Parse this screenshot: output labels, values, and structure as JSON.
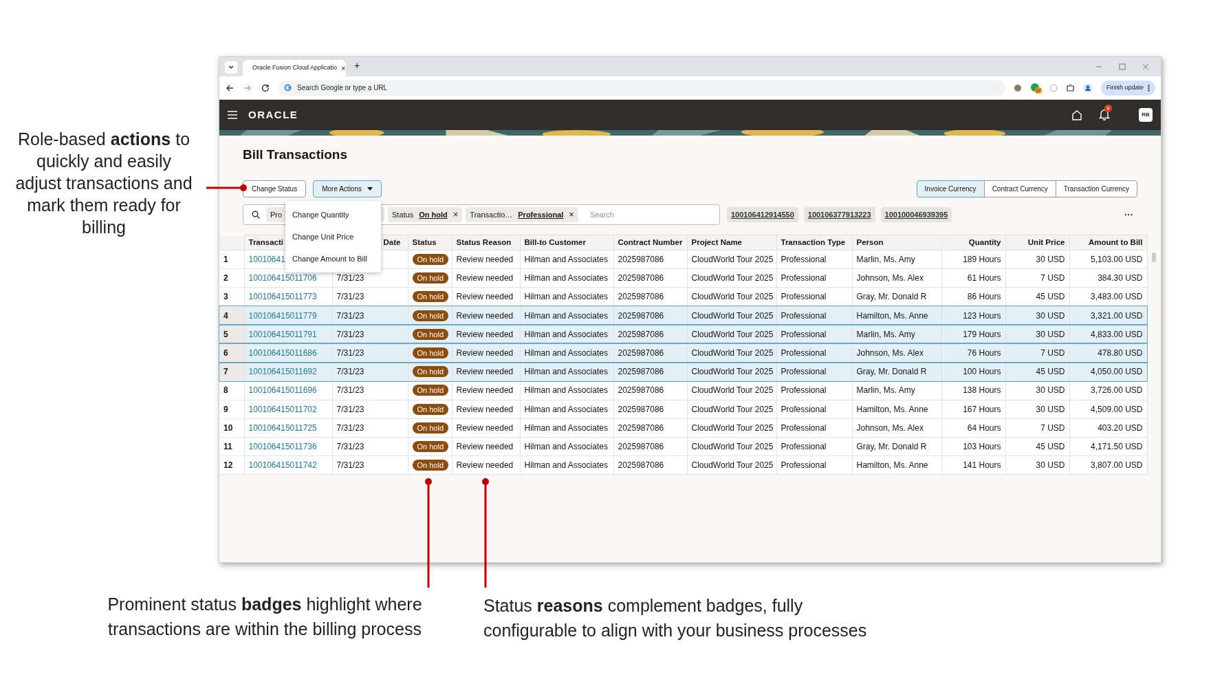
{
  "callouts": [
    {
      "text": "Role-based **actions** to quickly and easily adjust transactions and mark them ready for billing"
    },
    {
      "text": "Prominent status **badges** highlight where transactions are within the billing process"
    },
    {
      "text": "Status **reasons** complement badges, fully configurable to align with your business processes"
    }
  ],
  "browser": {
    "tab_title": "Oracle Fusion Cloud Applicatio",
    "tab_close": "×",
    "new_tab": "+",
    "address_placeholder": "Search Google or type a URL",
    "extension_badge": "37",
    "update_button": "Finish update"
  },
  "app_header": {
    "logo": "ORACLE",
    "notification_count": "9",
    "avatar": "RB"
  },
  "page_title": "Bill Transactions",
  "actions": [
    {
      "label": "Change Status",
      "kind": "button"
    },
    {
      "label": "More Actions",
      "kind": "menu"
    }
  ],
  "action_menu": [
    "Change Quantity",
    "Change Unit Price",
    "Change Amount to Bill"
  ],
  "currency_toggle": [
    {
      "label": "Invoice Currency",
      "selected": true
    },
    {
      "label": "Contract Currency",
      "selected": false
    },
    {
      "label": "Transaction Currency",
      "selected": false
    }
  ],
  "filters": [
    {
      "name": "Pro"
    },
    {
      "name": "Status",
      "value": "On hold",
      "remove": "×"
    },
    {
      "name": "Transactio…",
      "value": "Professional",
      "remove": "×"
    }
  ],
  "search_placeholder": "Search",
  "saved_searches": [
    "100106412914550",
    "100106377913223",
    "100100046939395"
  ],
  "overflow": "···",
  "table": {
    "columns": [
      "Transacti",
      "Date",
      "Status",
      "Status Reason",
      "Bill-to Customer",
      "Contract Number",
      "Project Name",
      "Transaction Type",
      "Person",
      "Quantity",
      "Unit Price",
      "Amount to Bill"
    ],
    "rows": [
      {
        "number": "1",
        "transaction": "10010641",
        "status": "On hold",
        "reason": "Review needed",
        "customer": "Hilman and Associates",
        "contract": "2025987086",
        "project": "CloudWorld Tour 2025",
        "type": "Professional",
        "person": "Marlin, Ms. Amy",
        "quantity": "189 Hours",
        "unit_price": "30 USD",
        "amount": "5,103.00 USD",
        "selected": false
      },
      {
        "number": "2",
        "transaction": "100106415011706",
        "date": "7/31/23",
        "status": "On hold",
        "reason": "Review needed",
        "customer": "Hilman and Associates",
        "contract": "2025987086",
        "project": "CloudWorld Tour 2025",
        "type": "Professional",
        "person": "Johnson, Ms. Alex",
        "quantity": "61 Hours",
        "unit_price": "7 USD",
        "amount": "384.30 USD",
        "selected": false
      },
      {
        "number": "3",
        "transaction": "100106415011773",
        "date": "7/31/23",
        "status": "On hold",
        "reason": "Review needed",
        "customer": "Hilman and Associates",
        "contract": "2025987086",
        "project": "CloudWorld Tour 2025",
        "type": "Professional",
        "person": "Gray, Mr. Donald R",
        "quantity": "86 Hours",
        "unit_price": "45 USD",
        "amount": "3,483.00 USD",
        "selected": false
      },
      {
        "number": "4",
        "transaction": "100106415011779",
        "date": "7/31/23",
        "status": "On hold",
        "reason": "Review needed",
        "customer": "Hilman and Associates",
        "contract": "2025987086",
        "project": "CloudWorld Tour 2025",
        "type": "Professional",
        "person": "Hamilton, Ms. Anne",
        "quantity": "123 Hours",
        "unit_price": "30 USD",
        "amount": "3,321.00 USD",
        "selected": true
      },
      {
        "number": "5",
        "transaction": "100106415011791",
        "date": "7/31/23",
        "status": "On hold",
        "reason": "Review needed",
        "customer": "Hilman and Associates",
        "contract": "2025987086",
        "project": "CloudWorld Tour 2025",
        "type": "Professional",
        "person": "Marlin, Ms. Amy",
        "quantity": "179 Hours",
        "unit_price": "30 USD",
        "amount": "4,833.00 USD",
        "selected": true
      },
      {
        "number": "6",
        "transaction": "100106415011686",
        "date": "7/31/23",
        "status": "On hold",
        "reason": "Review needed",
        "customer": "Hilman and Associates",
        "contract": "2025987086",
        "project": "CloudWorld Tour 2025",
        "type": "Professional",
        "person": "Johnson, Ms. Alex",
        "quantity": "76 Hours",
        "unit_price": "7 USD",
        "amount": "478.80 USD",
        "selected": true
      },
      {
        "number": "7",
        "transaction": "100106415011692",
        "date": "7/31/23",
        "status": "On hold",
        "reason": "Review needed",
        "customer": "Hilman and Associates",
        "contract": "2025987086",
        "project": "CloudWorld Tour 2025",
        "type": "Professional",
        "person": "Gray, Mr. Donald R",
        "quantity": "100 Hours",
        "unit_price": "45 USD",
        "amount": "4,050.00 USD",
        "selected": true
      },
      {
        "number": "8",
        "transaction": "100106415011696",
        "date": "7/31/23",
        "status": "On hold",
        "reason": "Review needed",
        "customer": "Hilman and Associates",
        "contract": "2025987086",
        "project": "CloudWorld Tour 2025",
        "type": "Professional",
        "person": "Marlin, Ms. Amy",
        "quantity": "138 Hours",
        "unit_price": "30 USD",
        "amount": "3,726.00 USD",
        "selected": false
      },
      {
        "number": "9",
        "transaction": "100106415011702",
        "date": "7/31/23",
        "status": "On hold",
        "reason": "Review needed",
        "customer": "Hilman and Associates",
        "contract": "2025987086",
        "project": "CloudWorld Tour 2025",
        "type": "Professional",
        "person": "Hamilton, Ms. Anne",
        "quantity": "167 Hours",
        "unit_price": "30 USD",
        "amount": "4,509.00 USD",
        "selected": false
      },
      {
        "number": "10",
        "transaction": "100106415011725",
        "date": "7/31/23",
        "status": "On hold",
        "reason": "Review needed",
        "customer": "Hilman and Associates",
        "contract": "2025987086",
        "project": "CloudWorld Tour 2025",
        "type": "Professional",
        "person": "Johnson, Ms. Alex",
        "quantity": "64 Hours",
        "unit_price": "7 USD",
        "amount": "403.20 USD",
        "selected": false
      },
      {
        "number": "11",
        "transaction": "100106415011736",
        "date": "7/31/23",
        "status": "On hold",
        "reason": "Review needed",
        "customer": "Hilman and Associates",
        "contract": "2025987086",
        "project": "CloudWorld Tour 2025",
        "type": "Professional",
        "person": "Gray, Mr. Donald R",
        "quantity": "103 Hours",
        "unit_price": "45 USD",
        "amount": "4,171.50 USD",
        "selected": false
      },
      {
        "number": "12",
        "transaction": "100106415011742",
        "date": "7/31/23",
        "status": "On hold",
        "reason": "Review needed",
        "customer": "Hilman and Associates",
        "contract": "2025987086",
        "project": "CloudWorld Tour 2025",
        "type": "Professional",
        "person": "Hamilton, Ms. Anne",
        "quantity": "141 Hours",
        "unit_price": "30 USD",
        "amount": "3,807.00 USD",
        "selected": false
      }
    ]
  }
}
